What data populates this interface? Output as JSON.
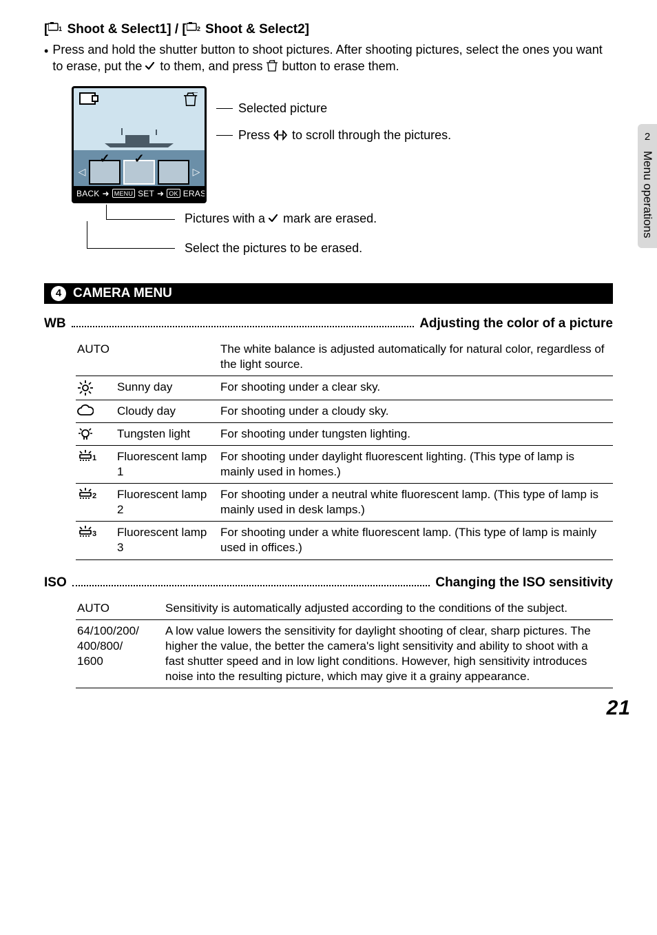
{
  "sideTab": {
    "number": "2",
    "label": "Menu operations"
  },
  "pageNumber": "21",
  "shoot": {
    "heading_prefix": "[",
    "heading_mid": " Shoot & Select1] / [",
    "heading_suffix": " Shoot & Select2]",
    "bullet": "Press and hold the shutter button to shoot pictures. After shooting pictures, select the ones you want to erase, put the ",
    "bullet_mid": " to them, and press ",
    "bullet_end": " button to erase them.",
    "label_selected": "Selected picture",
    "label_press_prefix": "Press ",
    "label_press_suffix": " to scroll through the pictures.",
    "label_marked_prefix": "Pictures with a ",
    "label_marked_suffix": " mark are erased.",
    "label_select": "Select the pictures to be erased.",
    "lcd_footer": {
      "back": "BACK",
      "menu": "MENU",
      "set": "SET",
      "ok": "OK",
      "erase": "ERASE"
    }
  },
  "cameraMenu": {
    "num": "4",
    "title": "CAMERA MENU"
  },
  "wb": {
    "key": "WB",
    "desc": "Adjusting the color of a picture",
    "rows": [
      {
        "c1": "AUTO",
        "c2": "",
        "c3": "The white balance is adjusted automatically for natural color, regardless of the light source."
      },
      {
        "c1_icon": "sun",
        "c2": "Sunny day",
        "c3": "For shooting under a clear sky."
      },
      {
        "c1_icon": "cloud",
        "c2": "Cloudy day",
        "c3": "For shooting under a cloudy sky."
      },
      {
        "c1_icon": "bulb",
        "c2": "Tungsten light",
        "c3": "For shooting under tungsten lighting."
      },
      {
        "c1_icon": "fluor1",
        "c2": "Fluorescent lamp 1",
        "c3": "For shooting under daylight fluorescent lighting. (This type of lamp is mainly used in homes.)"
      },
      {
        "c1_icon": "fluor2",
        "c2": "Fluorescent lamp 2",
        "c3": "For shooting under a neutral white fluorescent lamp. (This type of lamp is mainly used in desk lamps.)"
      },
      {
        "c1_icon": "fluor3",
        "c2": "Fluorescent lamp 3",
        "c3": "For shooting under a white fluorescent lamp. (This type of lamp is mainly used in offices.)"
      }
    ]
  },
  "iso": {
    "key": "ISO",
    "desc": "Changing the ISO sensitivity",
    "rows": [
      {
        "c1": "AUTO",
        "c3": "Sensitivity is automatically adjusted according to the conditions of the subject."
      },
      {
        "c1": "64/100/200/\n400/800/\n1600",
        "c3": "A low value lowers the sensitivity for daylight shooting of clear, sharp pictures. The higher the value, the better the camera's light sensitivity and ability to shoot with a fast shutter speed and in low light conditions. However, high sensitivity introduces noise into the resulting picture, which may give it a grainy appearance."
      }
    ]
  }
}
